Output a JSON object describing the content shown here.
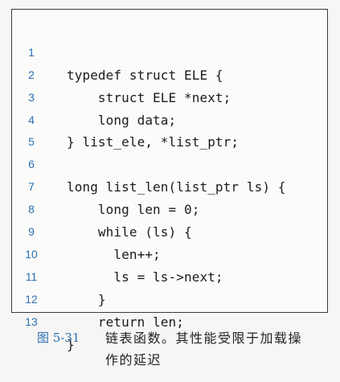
{
  "code": {
    "lines": [
      {
        "no": "1",
        "text": "typedef struct ELE {"
      },
      {
        "no": "2",
        "text": "    struct ELE *next;"
      },
      {
        "no": "3",
        "text": "    long data;"
      },
      {
        "no": "4",
        "text": "} list_ele, *list_ptr;"
      },
      {
        "no": "5",
        "text": ""
      },
      {
        "no": "6",
        "text": "long list_len(list_ptr ls) {"
      },
      {
        "no": "7",
        "text": "    long len = 0;"
      },
      {
        "no": "8",
        "text": "    while (ls) {"
      },
      {
        "no": "9",
        "text": "      len++;"
      },
      {
        "no": "10",
        "text": "      ls = ls->next;"
      },
      {
        "no": "11",
        "text": "    }"
      },
      {
        "no": "12",
        "text": "    return len;"
      },
      {
        "no": "13",
        "text": "}"
      }
    ]
  },
  "caption": {
    "label": "图 5-31",
    "text": "链表函数。其性能受限于加载操作的延迟"
  },
  "colors": {
    "line_number": "#2c6fb3",
    "code_text": "#1b1b1b",
    "border": "#3a3a3a"
  }
}
